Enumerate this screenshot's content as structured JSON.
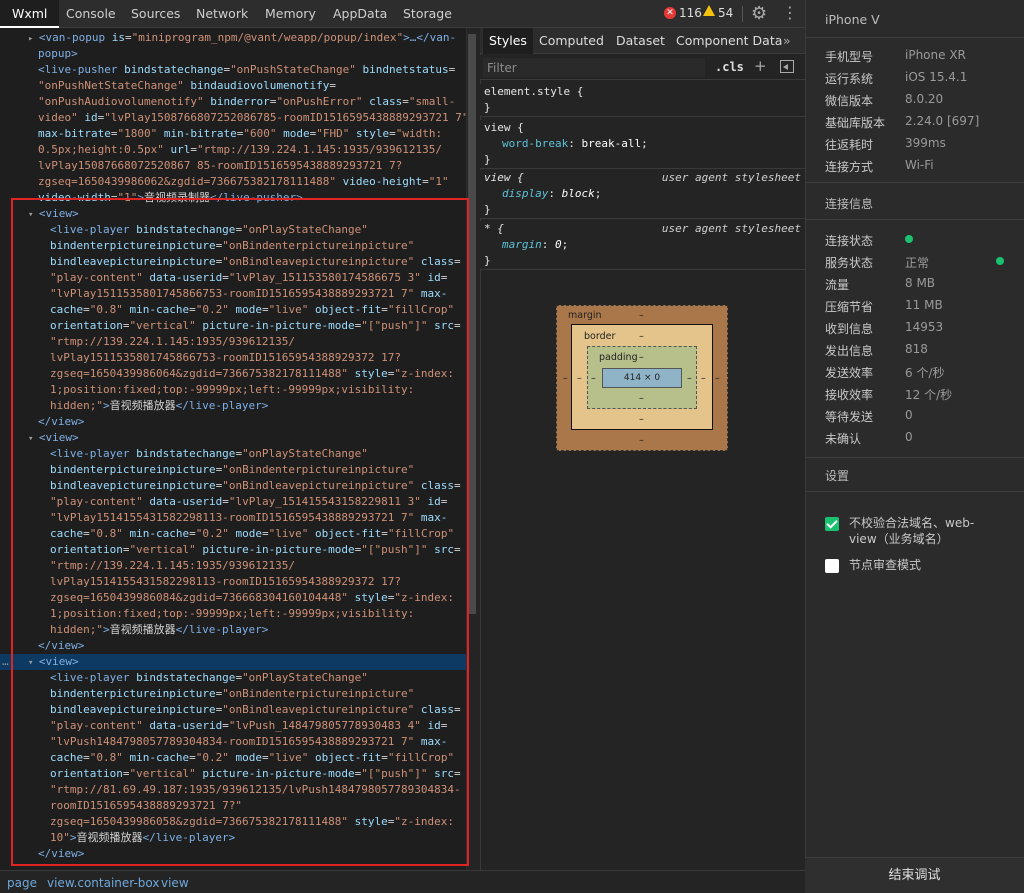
{
  "tabs": [
    "Wxml",
    "Console",
    "Sources",
    "Network",
    "Memory",
    "AppData",
    "Storage"
  ],
  "error_count": "116",
  "warning_count": "54",
  "tree_lines": [
    [
      [
        "arrow",
        "▸ "
      ],
      [
        "tg",
        "<van-popup "
      ],
      [
        "at",
        "is"
      ],
      [
        "tx",
        "="
      ],
      [
        "av",
        "\"miniprogram_npm/@vant/weapp/popup/index\""
      ],
      [
        "tg",
        ">…</van-"
      ]
    ],
    [
      [
        "tg",
        "popup>"
      ]
    ],
    [
      [
        "tg",
        "<live-pusher "
      ],
      [
        "at",
        "bindstatechange"
      ],
      [
        "tx",
        "="
      ],
      [
        "av",
        "\"onPushStateChange\""
      ],
      [
        "at",
        " bindnetstatus"
      ],
      [
        "tx",
        "="
      ]
    ],
    [
      [
        "av",
        "\"onPushNetStateChange\""
      ],
      [
        "at",
        " bindaudiovolumenotify"
      ],
      [
        "tx",
        "="
      ]
    ],
    [
      [
        "av",
        "\"onPushAudiovolumenotify\""
      ],
      [
        "at",
        " binderror"
      ],
      [
        "tx",
        "="
      ],
      [
        "av",
        "\"onPushError\""
      ],
      [
        "at",
        " class"
      ],
      [
        "tx",
        "="
      ],
      [
        "av",
        "\"small-"
      ]
    ],
    [
      [
        "av",
        "video\""
      ],
      [
        "at",
        " id"
      ],
      [
        "tx",
        "="
      ],
      [
        "av",
        "\"lvPlay150876680725208678­5-roomID1516595438889293721 7\""
      ]
    ],
    [
      [
        "at",
        "max-bitrate"
      ],
      [
        "tx",
        "="
      ],
      [
        "av",
        "\"1800\""
      ],
      [
        "at",
        " min-bitrate"
      ],
      [
        "tx",
        "="
      ],
      [
        "av",
        "\"600\""
      ],
      [
        "at",
        " mode"
      ],
      [
        "tx",
        "="
      ],
      [
        "av",
        "\"FHD\""
      ],
      [
        "at",
        " style"
      ],
      [
        "tx",
        "="
      ],
      [
        "av",
        "\"width:"
      ]
    ],
    [
      [
        "av",
        "0.5px;height:0.5px\""
      ],
      [
        "at",
        " url"
      ],
      [
        "tx",
        "="
      ],
      [
        "av",
        "\"rtmp://139.224.1.145:1935/939612135/"
      ]
    ],
    [
      [
        "av",
        "lvPlay15087668072520867 85-roomID1516595438889293721 7?"
      ]
    ],
    [
      [
        "av",
        "zgseq=1650439986062&zgdid=736675382178111488\""
      ],
      [
        "at",
        " video-height"
      ],
      [
        "tx",
        "="
      ],
      [
        "av",
        "\"1\""
      ]
    ],
    [
      [
        "at",
        "video-width"
      ],
      [
        "tx",
        "="
      ],
      [
        "av",
        "\"1\""
      ],
      [
        "tg",
        ">"
      ],
      [
        "tx",
        "音视频录制器"
      ],
      [
        "tg",
        "</live-pusher>"
      ]
    ],
    [
      [
        "arrow",
        "▾ "
      ],
      [
        "tg",
        "<view>"
      ]
    ],
    [
      [
        "tg",
        "<live-player "
      ],
      [
        "at",
        "bindstatechange"
      ],
      [
        "tx",
        "="
      ],
      [
        "av",
        "\"onPlayStateChange\""
      ]
    ],
    [
      [
        "at",
        "bindenterpictureinpicture"
      ],
      [
        "tx",
        "="
      ],
      [
        "av",
        "\"onBindenterpictureinpicture\""
      ]
    ],
    [
      [
        "at",
        "bindleavepictureinpicture"
      ],
      [
        "tx",
        "="
      ],
      [
        "av",
        "\"onBindleavepictureinpicture\""
      ],
      [
        "at",
        " class"
      ],
      [
        "tx",
        "="
      ]
    ],
    [
      [
        "av",
        "\"play-content\""
      ],
      [
        "at",
        " data-userid"
      ],
      [
        "tx",
        "="
      ],
      [
        "av",
        "\"lvPlay_151153580174586675 3\""
      ],
      [
        "at",
        " id"
      ],
      [
        "tx",
        "="
      ]
    ],
    [
      [
        "av",
        "\"lvPlay1511535801745866753-roomID1516595438889293721 7\""
      ],
      [
        "at",
        " max-"
      ]
    ],
    [
      [
        "at",
        "cache"
      ],
      [
        "tx",
        "="
      ],
      [
        "av",
        "\"0.8\""
      ],
      [
        "at",
        " min-cache"
      ],
      [
        "tx",
        "="
      ],
      [
        "av",
        "\"0.2\""
      ],
      [
        "at",
        " mode"
      ],
      [
        "tx",
        "="
      ],
      [
        "av",
        "\"live\""
      ],
      [
        "at",
        " object-fit"
      ],
      [
        "tx",
        "="
      ],
      [
        "av",
        "\"fillCrop\""
      ]
    ],
    [
      [
        "at",
        "orientation"
      ],
      [
        "tx",
        "="
      ],
      [
        "av",
        "\"vertical\""
      ],
      [
        "at",
        " picture-in-picture-mode"
      ],
      [
        "tx",
        "="
      ],
      [
        "av",
        "\"[\"push\"]\""
      ],
      [
        "at",
        " src"
      ],
      [
        "tx",
        "="
      ]
    ],
    [
      [
        "av",
        "\"rtmp://139.224.1.145:1935/939612135/"
      ]
    ],
    [
      [
        "av",
        "lvPlay1511535801745866753-roomID15165954388929372 17?"
      ]
    ],
    [
      [
        "av",
        "zgseq=1650439986064&zgdid=736675382178111488\""
      ],
      [
        "at",
        " style"
      ],
      [
        "tx",
        "="
      ],
      [
        "av",
        "\"z-index:"
      ]
    ],
    [
      [
        "av",
        "1;position:fixed;top:-99999px;left:-99999px;visibility:"
      ]
    ],
    [
      [
        "av",
        "hidden;\""
      ],
      [
        "tg",
        ">"
      ],
      [
        "tx",
        "音视频播放器"
      ],
      [
        "tg",
        "</live-player>"
      ]
    ],
    [
      [
        "tg",
        "</view>"
      ]
    ],
    [
      [
        "arrow",
        "▾ "
      ],
      [
        "tg",
        "<view>"
      ]
    ],
    [
      [
        "tg",
        "<live-player "
      ],
      [
        "at",
        "bindstatechange"
      ],
      [
        "tx",
        "="
      ],
      [
        "av",
        "\"onPlayStateChange\""
      ]
    ],
    [
      [
        "at",
        "bindenterpictureinpicture"
      ],
      [
        "tx",
        "="
      ],
      [
        "av",
        "\"onBindenterpictureinpicture\""
      ]
    ],
    [
      [
        "at",
        "bindleavepictureinpicture"
      ],
      [
        "tx",
        "="
      ],
      [
        "av",
        "\"onBindleavepictureinpicture\""
      ],
      [
        "at",
        " class"
      ],
      [
        "tx",
        "="
      ]
    ],
    [
      [
        "av",
        "\"play-content\""
      ],
      [
        "at",
        " data-userid"
      ],
      [
        "tx",
        "="
      ],
      [
        "av",
        "\"lvPlay_151415543158229811 3\""
      ],
      [
        "at",
        " id"
      ],
      [
        "tx",
        "="
      ]
    ],
    [
      [
        "av",
        "\"lvPlay1514155431582298113-roomID1516595438889293721 7\""
      ],
      [
        "at",
        " max-"
      ]
    ],
    [
      [
        "at",
        "cache"
      ],
      [
        "tx",
        "="
      ],
      [
        "av",
        "\"0.8\""
      ],
      [
        "at",
        " min-cache"
      ],
      [
        "tx",
        "="
      ],
      [
        "av",
        "\"0.2\""
      ],
      [
        "at",
        " mode"
      ],
      [
        "tx",
        "="
      ],
      [
        "av",
        "\"live\""
      ],
      [
        "at",
        " object-fit"
      ],
      [
        "tx",
        "="
      ],
      [
        "av",
        "\"fillCrop\""
      ]
    ],
    [
      [
        "at",
        "orientation"
      ],
      [
        "tx",
        "="
      ],
      [
        "av",
        "\"vertical\""
      ],
      [
        "at",
        " picture-in-picture-mode"
      ],
      [
        "tx",
        "="
      ],
      [
        "av",
        "\"[\"push\"]\""
      ],
      [
        "at",
        " src"
      ],
      [
        "tx",
        "="
      ]
    ],
    [
      [
        "av",
        "\"rtmp://139.224.1.145:1935/939612135/"
      ]
    ],
    [
      [
        "av",
        "lvPlay1514155431582298113-roomID15165954388929372 17?"
      ]
    ],
    [
      [
        "av",
        "zgseq=1650439986084&zgdid=736668304160104448\""
      ],
      [
        "at",
        " style"
      ],
      [
        "tx",
        "="
      ],
      [
        "av",
        "\"z-index:"
      ]
    ],
    [
      [
        "av",
        "1;position:fixed;top:-99999px;left:-99999px;visibility:"
      ]
    ],
    [
      [
        "av",
        "hidden;\""
      ],
      [
        "tg",
        ">"
      ],
      [
        "tx",
        "音视频播放器"
      ],
      [
        "tg",
        "</live-player>"
      ]
    ],
    [
      [
        "tg",
        "</view>"
      ]
    ],
    [
      [
        "arrow",
        "▾ "
      ],
      [
        "tg",
        "<view>"
      ]
    ],
    [
      [
        "tg",
        "<live-player "
      ],
      [
        "at",
        "bindstatechange"
      ],
      [
        "tx",
        "="
      ],
      [
        "av",
        "\"onPlayStateChange\""
      ]
    ],
    [
      [
        "at",
        "bindenterpictureinpicture"
      ],
      [
        "tx",
        "="
      ],
      [
        "av",
        "\"onBindenterpictureinpicture\""
      ]
    ],
    [
      [
        "at",
        "bindleavepictureinpicture"
      ],
      [
        "tx",
        "="
      ],
      [
        "av",
        "\"onBindleavepictureinpicture\""
      ],
      [
        "at",
        " class"
      ],
      [
        "tx",
        "="
      ]
    ],
    [
      [
        "av",
        "\"play-content\""
      ],
      [
        "at",
        " data-userid"
      ],
      [
        "tx",
        "="
      ],
      [
        "av",
        "\"lvPush_148479805778930483 4\""
      ],
      [
        "at",
        " id"
      ],
      [
        "tx",
        "="
      ]
    ],
    [
      [
        "av",
        "\"lvPush1484798057789304834-roomID1516595438889293721 7\""
      ],
      [
        "at",
        " max-"
      ]
    ],
    [
      [
        "at",
        "cache"
      ],
      [
        "tx",
        "="
      ],
      [
        "av",
        "\"0.8\""
      ],
      [
        "at",
        " min-cache"
      ],
      [
        "tx",
        "="
      ],
      [
        "av",
        "\"0.2\""
      ],
      [
        "at",
        " mode"
      ],
      [
        "tx",
        "="
      ],
      [
        "av",
        "\"live\""
      ],
      [
        "at",
        " object-fit"
      ],
      [
        "tx",
        "="
      ],
      [
        "av",
        "\"fillCrop\""
      ]
    ],
    [
      [
        "at",
        "orientation"
      ],
      [
        "tx",
        "="
      ],
      [
        "av",
        "\"vertical\""
      ],
      [
        "at",
        " picture-in-picture-mode"
      ],
      [
        "tx",
        "="
      ],
      [
        "av",
        "\"[\"push\"]\""
      ],
      [
        "at",
        " src"
      ],
      [
        "tx",
        "="
      ]
    ],
    [
      [
        "av",
        "\"rtmp://81.69.49.187:1935/939612135/lvPush1484798057789304834-"
      ]
    ],
    [
      [
        "av",
        "roomID1516595438889293721 7?\""
      ]
    ],
    [
      [
        "av",
        "zgseq=1650439986058&zgdid=736675382178111488\""
      ],
      [
        "at",
        " style"
      ],
      [
        "tx",
        "="
      ],
      [
        "av",
        "\"z-index:"
      ]
    ],
    [
      [
        "av",
        "10\""
      ],
      [
        "tg",
        ">"
      ],
      [
        "tx",
        "音视频播放器"
      ],
      [
        "tg",
        "</live-player>"
      ]
    ],
    [
      [
        "tg",
        "</view>"
      ]
    ]
  ],
  "style_tabs": [
    "Styles",
    "Computed",
    "Dataset",
    "Component Data"
  ],
  "filter_placeholder": "Filter",
  "cls_label": ".cls",
  "rules": [
    {
      "selector": "element.style {",
      "origin": "",
      "decls": [],
      "close": "}"
    },
    {
      "selector": "view {",
      "origin": "",
      "decls": [
        {
          "prop": "word-break",
          "value": "break-all"
        }
      ],
      "close": "}"
    },
    {
      "selector": "view {",
      "origin": "user agent stylesheet",
      "decls": [
        {
          "prop": "display",
          "value": "block"
        }
      ],
      "close": "}"
    },
    {
      "selector": "* {",
      "origin": "user agent stylesheet",
      "decls": [
        {
          "prop": "margin",
          "value": "0"
        }
      ],
      "close": "}"
    }
  ],
  "box_model": {
    "margin_label": "margin",
    "border_label": "border",
    "padding_label": "padding",
    "dash": "–",
    "content": "414 × 0"
  },
  "breadcrumbs": [
    "page",
    "view.container-box",
    "view"
  ],
  "device": {
    "title": "iPhone V",
    "info": [
      {
        "label": "手机型号",
        "value": "iPhone XR"
      },
      {
        "label": "运行系统",
        "value": "iOS 15.4.1"
      },
      {
        "label": "微信版本",
        "value": "8.0.20"
      },
      {
        "label": "基础库版本",
        "value": "2.24.0 [697]"
      },
      {
        "label": "往返耗时",
        "value": "399ms"
      },
      {
        "label": "连接方式",
        "value": "Wi-Fi"
      }
    ],
    "conn_title": "连接信息",
    "conn": [
      {
        "label": "连接状态",
        "value": ""
      },
      {
        "label": "服务状态",
        "value": "正常"
      },
      {
        "label": "流量",
        "value": "8 MB"
      },
      {
        "label": "压缩节省",
        "value": "11 MB"
      },
      {
        "label": "收到信息",
        "value": "14953"
      },
      {
        "label": "发出信息",
        "value": "818"
      },
      {
        "label": "发送效率",
        "value": "6 个/秒"
      },
      {
        "label": "接收效率",
        "value": "12 个/秒"
      },
      {
        "label": "等待发送",
        "value": "0"
      },
      {
        "label": "未确认",
        "value": "0"
      }
    ],
    "settings_title": "设置",
    "opt1_line1": "不校验合法域名、web-",
    "opt1_line2": "view（业务域名）",
    "opt2": "节点审查模式",
    "end_button": "结束调试"
  },
  "colors": {
    "accent_green": "#1ac16f",
    "selection": "#0d3a62",
    "red_box": "#e02424"
  }
}
